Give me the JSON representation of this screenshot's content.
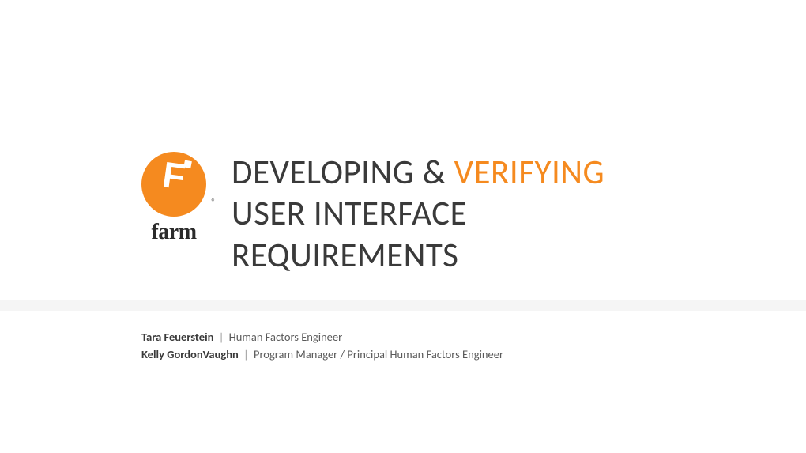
{
  "logo": {
    "letter": "F",
    "word": "farm",
    "registered": "®"
  },
  "title": {
    "line1_a": "DEVELOPING & ",
    "line1_b": "VERIFYING",
    "line2": "USER INTERFACE",
    "line3": "REQUIREMENTS"
  },
  "authors": [
    {
      "name": "Tara Feuerstein",
      "sep": " | ",
      "role": "Human Factors Engineer"
    },
    {
      "name": "Kelly GordonVaughn",
      "sep": " | ",
      "role": "Program Manager / Principal Human Factors Engineer"
    }
  ],
  "colors": {
    "accent": "#f58a1f",
    "text": "#3a3a3a",
    "muted": "#5a5a5a",
    "dividerBg": "#f5f5f5"
  }
}
